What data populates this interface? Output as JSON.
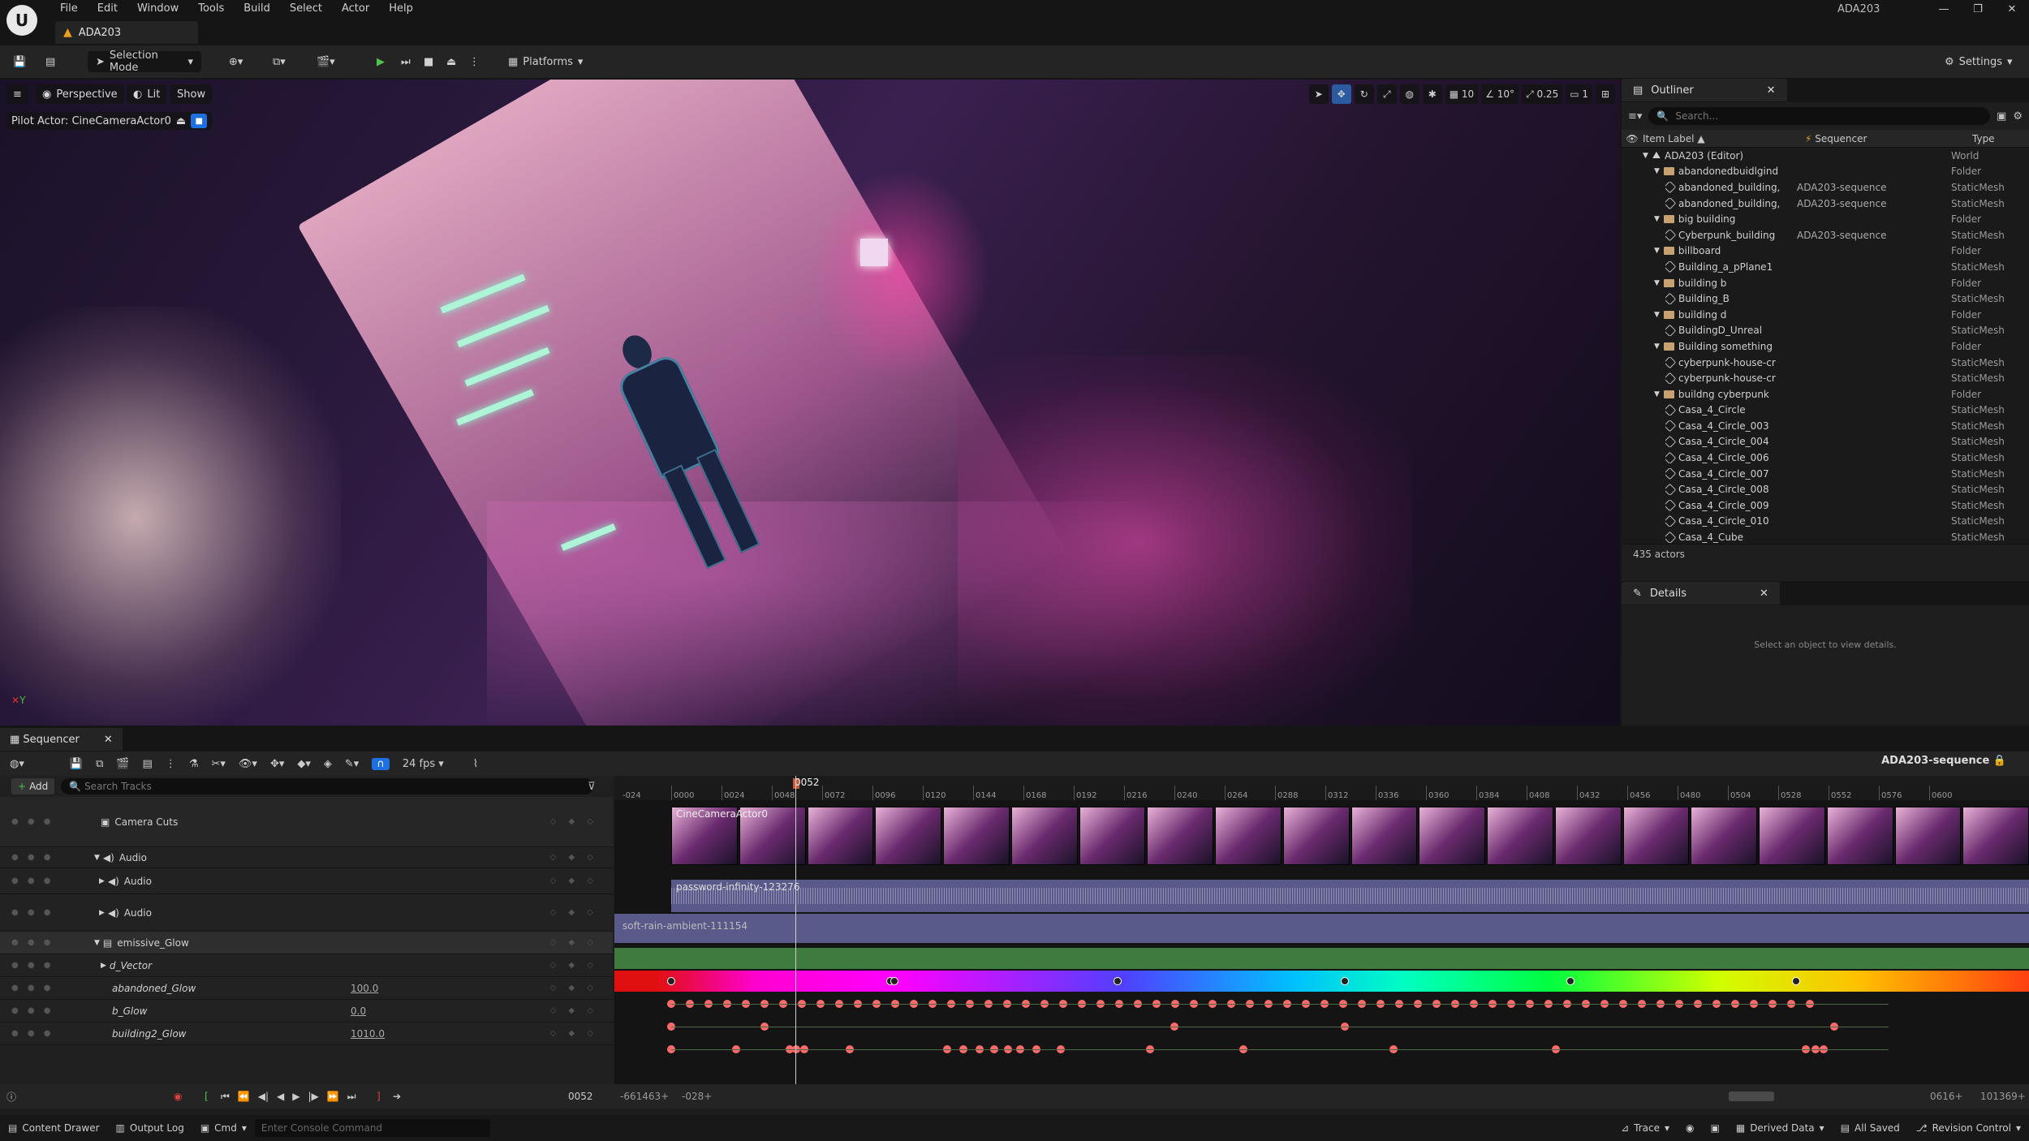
{
  "menu": [
    "File",
    "Edit",
    "Window",
    "Tools",
    "Build",
    "Select",
    "Actor",
    "Help"
  ],
  "document_tab": "ADA203",
  "window_title": "ADA203",
  "toolbar": {
    "selection_mode": "Selection Mode",
    "platforms": "Platforms",
    "settings": "Settings"
  },
  "viewport": {
    "perspective": "Perspective",
    "lit": "Lit",
    "show": "Show",
    "pilot_actor": "Pilot Actor: CineCameraActor0",
    "grid_size": "10",
    "angle": "10°",
    "scale": "0.25",
    "camera_speed": "1"
  },
  "outliner": {
    "tab": "Outliner",
    "search_placeholder": "Search...",
    "col_label": "Item Label",
    "col_sequencer": "Sequencer",
    "col_type": "Type",
    "rows": [
      {
        "label": "ADA203 (Editor)",
        "seq": "",
        "type": "World",
        "kind": "world",
        "indent": 0
      },
      {
        "label": "abandonedbuidlgind",
        "seq": "",
        "type": "Folder",
        "kind": "folder",
        "indent": 1
      },
      {
        "label": "abandoned_building,",
        "seq": "ADA203-sequence",
        "type": "StaticMesh",
        "kind": "mesh",
        "indent": 2
      },
      {
        "label": "abandoned_building,",
        "seq": "ADA203-sequence",
        "type": "StaticMesh",
        "kind": "mesh",
        "indent": 2
      },
      {
        "label": "big building",
        "seq": "",
        "type": "Folder",
        "kind": "folder",
        "indent": 1
      },
      {
        "label": "Cyberpunk_building",
        "seq": "ADA203-sequence",
        "type": "StaticMesh",
        "kind": "mesh",
        "indent": 2
      },
      {
        "label": "billboard",
        "seq": "",
        "type": "Folder",
        "kind": "folder",
        "indent": 1
      },
      {
        "label": "Building_a_pPlane1",
        "seq": "",
        "type": "StaticMesh",
        "kind": "mesh",
        "indent": 2
      },
      {
        "label": "building b",
        "seq": "",
        "type": "Folder",
        "kind": "folder",
        "indent": 1
      },
      {
        "label": "Building_B",
        "seq": "",
        "type": "StaticMesh",
        "kind": "mesh",
        "indent": 2
      },
      {
        "label": "building d",
        "seq": "",
        "type": "Folder",
        "kind": "folder",
        "indent": 1
      },
      {
        "label": "BuildingD_Unreal",
        "seq": "",
        "type": "StaticMesh",
        "kind": "mesh",
        "indent": 2
      },
      {
        "label": "Building something",
        "seq": "",
        "type": "Folder",
        "kind": "folder",
        "indent": 1
      },
      {
        "label": "cyberpunk-house-cr",
        "seq": "",
        "type": "StaticMesh",
        "kind": "mesh",
        "indent": 2
      },
      {
        "label": "cyberpunk-house-cr",
        "seq": "",
        "type": "StaticMesh",
        "kind": "mesh",
        "indent": 2
      },
      {
        "label": "buildng cyberpunk",
        "seq": "",
        "type": "Folder",
        "kind": "folder",
        "indent": 1
      },
      {
        "label": "Casa_4_Circle",
        "seq": "",
        "type": "StaticMesh",
        "kind": "mesh",
        "indent": 2
      },
      {
        "label": "Casa_4_Circle_003",
        "seq": "",
        "type": "StaticMesh",
        "kind": "mesh",
        "indent": 2
      },
      {
        "label": "Casa_4_Circle_004",
        "seq": "",
        "type": "StaticMesh",
        "kind": "mesh",
        "indent": 2
      },
      {
        "label": "Casa_4_Circle_006",
        "seq": "",
        "type": "StaticMesh",
        "kind": "mesh",
        "indent": 2
      },
      {
        "label": "Casa_4_Circle_007",
        "seq": "",
        "type": "StaticMesh",
        "kind": "mesh",
        "indent": 2
      },
      {
        "label": "Casa_4_Circle_008",
        "seq": "",
        "type": "StaticMesh",
        "kind": "mesh",
        "indent": 2
      },
      {
        "label": "Casa_4_Circle_009",
        "seq": "",
        "type": "StaticMesh",
        "kind": "mesh",
        "indent": 2
      },
      {
        "label": "Casa_4_Circle_010",
        "seq": "",
        "type": "StaticMesh",
        "kind": "mesh",
        "indent": 2
      },
      {
        "label": "Casa_4_Cube",
        "seq": "",
        "type": "StaticMesh",
        "kind": "mesh",
        "indent": 2
      }
    ],
    "actor_count": "435 actors"
  },
  "details": {
    "tab": "Details",
    "empty": "Select an object to view details."
  },
  "sequencer": {
    "tab": "Sequencer",
    "fps": "24 fps",
    "sequence_name": "ADA203-sequence",
    "add": "Add",
    "search_placeholder": "Search Tracks",
    "playhead_frame": "0052",
    "ruler_start": "-024",
    "ruler_ticks": [
      "0000",
      "0024",
      "0048",
      "0072",
      "0096",
      "0120",
      "0144",
      "0168",
      "0192",
      "0216",
      "0240",
      "0264",
      "0288",
      "0312",
      "0336",
      "0360",
      "0384",
      "0408",
      "0432",
      "0456",
      "0480",
      "0504",
      "0528",
      "0552",
      "0576",
      "0600"
    ],
    "tracks": [
      {
        "name": "Camera Cuts",
        "value": ""
      },
      {
        "name": "Audio",
        "value": ""
      },
      {
        "name": "Audio",
        "value": ""
      },
      {
        "name": "Audio",
        "value": ""
      },
      {
        "name": "emissive_Glow",
        "value": ""
      },
      {
        "name": "d_Vector",
        "value": ""
      },
      {
        "name": "abandoned_Glow",
        "value": "100.0"
      },
      {
        "name": "b_Glow",
        "value": "0.0"
      },
      {
        "name": "building2_Glow",
        "value": "1010.0"
      }
    ],
    "camera_clip": "CineCameraActor0",
    "audio_clip_1": "password-infinity-123276",
    "audio_clip_2": "soft-rain-ambient-111154",
    "current_frame": "0052",
    "view_start": "-661463+",
    "view_in": "-028+",
    "view_out": "0616+",
    "view_end": "101369+"
  },
  "statusbar": {
    "content_drawer": "Content Drawer",
    "output_log": "Output Log",
    "cmd": "Cmd",
    "console_placeholder": "Enter Console Command",
    "trace": "Trace",
    "derived_data": "Derived Data",
    "all_saved": "All Saved",
    "revision_control": "Revision Control"
  }
}
